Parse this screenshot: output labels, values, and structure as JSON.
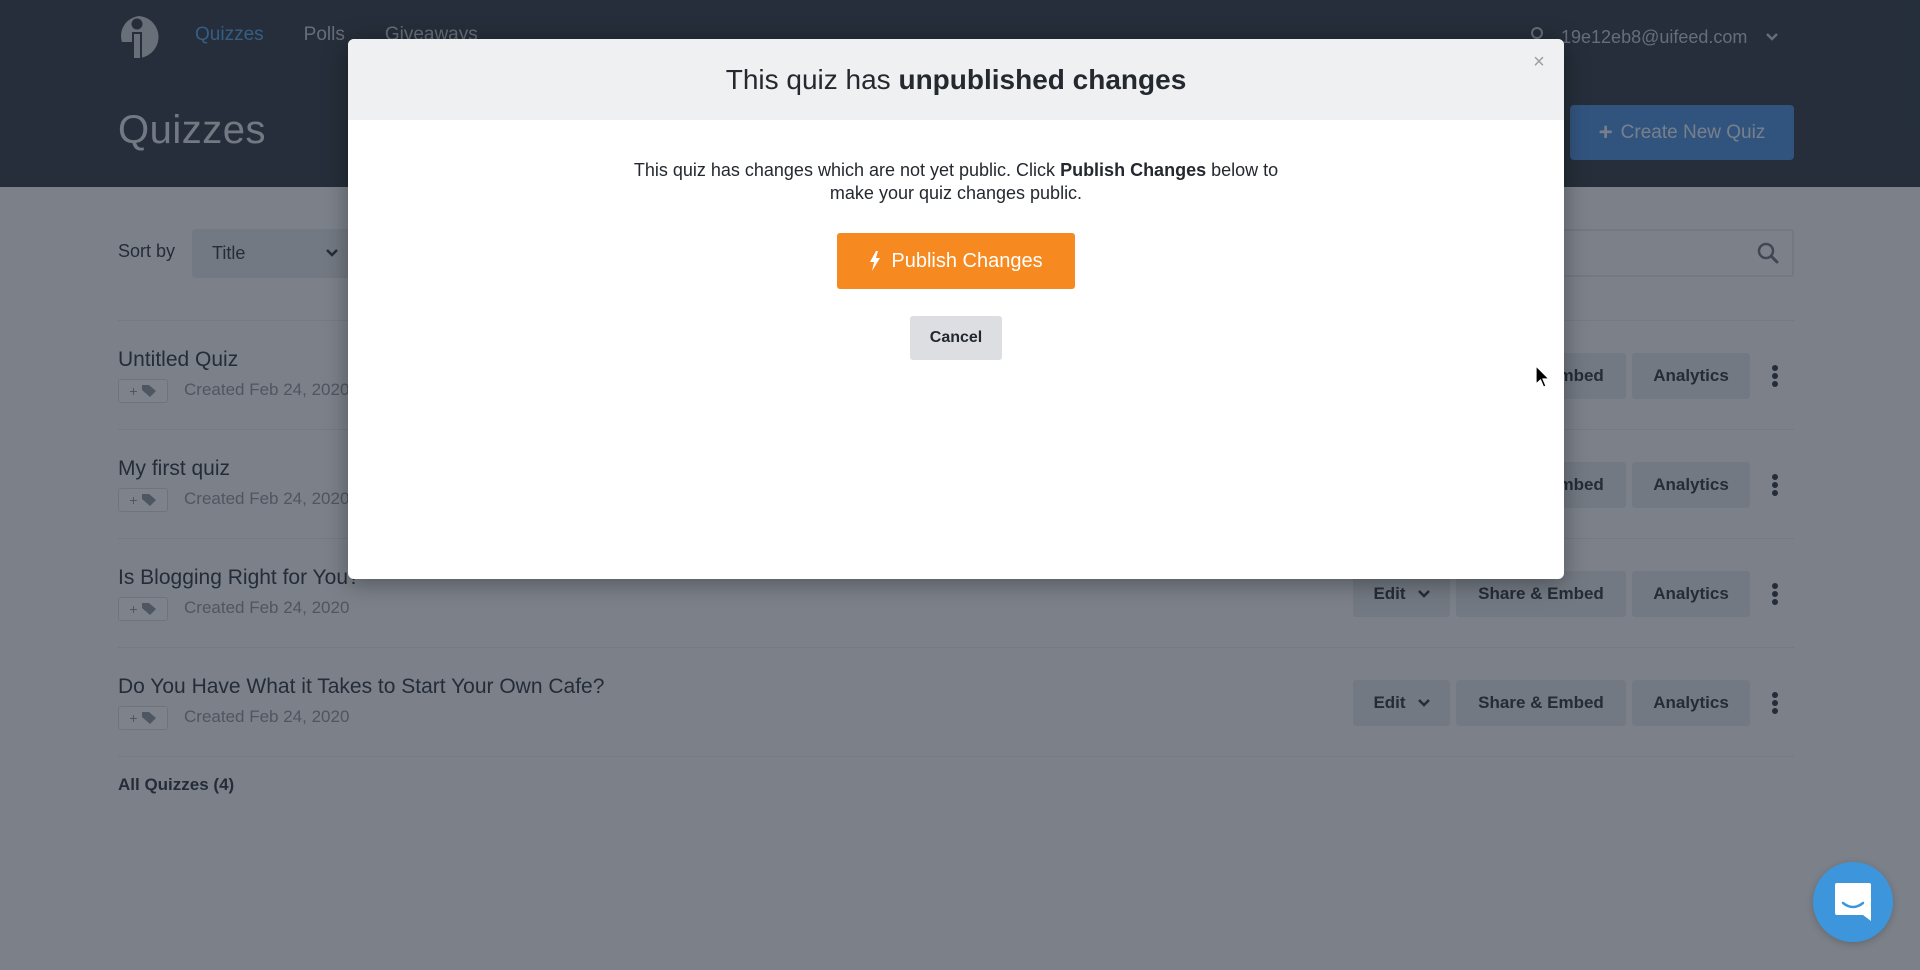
{
  "header": {
    "nav": [
      {
        "label": "Quizzes",
        "active": true
      },
      {
        "label": "Polls",
        "active": false
      },
      {
        "label": "Giveaways",
        "active": false
      }
    ],
    "user_email": "19e12eb8@uifeed.com",
    "page_title": "Quizzes",
    "create_button": "Create New Quiz"
  },
  "toolbar": {
    "sort_label": "Sort by",
    "sort_value": "Title",
    "search_placeholder": ""
  },
  "quizzes": [
    {
      "title": "Untitled Quiz",
      "created": "Created Feb 24, 2020"
    },
    {
      "title": "My first quiz",
      "created": "Created Feb 24, 2020"
    },
    {
      "title": "Is Blogging Right for You?",
      "created": "Created Feb 24, 2020"
    },
    {
      "title": "Do You Have What it Takes to Start Your Own Cafe?",
      "created": "Created Feb 24, 2020"
    }
  ],
  "row_actions": {
    "edit": "Edit",
    "share": "Share & Embed",
    "analytics": "Analytics"
  },
  "footer": {
    "all_quizzes": "All Quizzes (4)"
  },
  "modal": {
    "title_prefix": "This quiz has ",
    "title_bold": "unpublished changes",
    "close": "×",
    "text_part1": "This quiz has changes which are not yet public. Click ",
    "text_bold": "Publish Changes",
    "text_part2": " below to make your quiz changes public.",
    "publish_button": "Publish Changes",
    "cancel_button": "Cancel"
  },
  "colors": {
    "accent_blue": "#4a90e2",
    "publish_orange": "#f6891f",
    "chat_blue": "#3d96dc"
  }
}
